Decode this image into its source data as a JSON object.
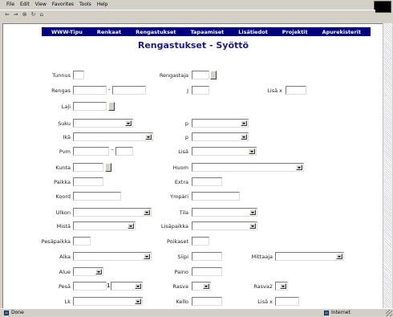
{
  "browser": {
    "menu": [
      "File",
      "Edit",
      "View",
      "Favorites",
      "Tools",
      "Help"
    ],
    "toolbar_icons": [
      "back-arrow-icon",
      "forward-arrow-icon",
      "stop-icon",
      "refresh-icon",
      "home-icon"
    ],
    "status_text": "Done",
    "zone_text": "Internet"
  },
  "nav": {
    "items": [
      "WWW-Tipu",
      "Renkaat",
      "Rengastukset",
      "Tapaamiset",
      "Lisätiedot",
      "Projektit",
      "Apurekisterit"
    ]
  },
  "page": {
    "title": "Rengastukset - Syöttö"
  },
  "form": {
    "tunnus": "Tunnus",
    "rengastaja": "Rengastaja",
    "rengas": "Rengas",
    "laji": "Laji",
    "ika": "Ikä",
    "sukupuoli": "Suku",
    "pvm": "Pvm",
    "kunta": "Kunta",
    "paikka": "Paikka",
    "koord": "Koord",
    "ulkon": "Ulkon",
    "tila": "Tila",
    "pesapaikka": "Pesäpaikka",
    "mista": "Mistä",
    "aika": "Aika",
    "alue": "Alue",
    "alue_sep": "-",
    "ika_p": "p",
    "suku_p": "p",
    "pvm_lisa": "Lisä",
    "kunta_huom": "Huom",
    "ppm_sep": "J",
    "paikka_lisa": "Lisäpaikka",
    "extra1": "Extra",
    "extra2": "Ympäri",
    "pesa": "Pesä",
    "poikaset": "Poikaset",
    "siipi": "Siipi",
    "paino": "Paino",
    "mittaaja": "Mittaaja",
    "rasva": "Rasva",
    "rasva2": "Rasva2",
    "kello": "Kello",
    "lisa_x": "Lisä x",
    "pvm_sep": "1",
    "huom2": "Lk"
  }
}
